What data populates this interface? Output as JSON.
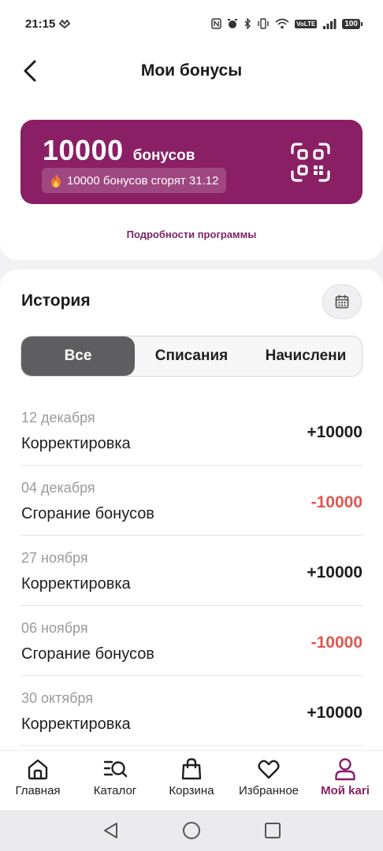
{
  "status_bar": {
    "time": "21:15",
    "battery": "100",
    "volte": "VoLTE"
  },
  "header": {
    "title": "Мои бонусы"
  },
  "bonus_card": {
    "amount": "10000",
    "unit": "бонусов",
    "expire_text": "10000 бонусов сгорят 31.12",
    "expire_icon": "fire-icon",
    "qr_icon": "qr-code-icon"
  },
  "program_link": "Подробности программы",
  "history": {
    "title": "История",
    "calendar_icon": "calendar-icon",
    "tabs": [
      {
        "label": "Все",
        "active": true
      },
      {
        "label": "Списания",
        "active": false
      },
      {
        "label": "Начислени",
        "active": false
      }
    ],
    "items": [
      {
        "date": "12 декабря",
        "title": "Корректировка",
        "amount": "+10000",
        "type": "plus"
      },
      {
        "date": "04 декабря",
        "title": "Сгорание бонусов",
        "amount": "-10000",
        "type": "minus"
      },
      {
        "date": "27 ноября",
        "title": "Корректировка",
        "amount": "+10000",
        "type": "plus"
      },
      {
        "date": "06 ноября",
        "title": "Сгорание бонусов",
        "amount": "-10000",
        "type": "minus"
      },
      {
        "date": "30 октября",
        "title": "Корректировка",
        "amount": "+10000",
        "type": "plus"
      }
    ]
  },
  "bottom_nav": [
    {
      "label": "Главная",
      "icon": "home-icon",
      "active": false
    },
    {
      "label": "Каталог",
      "icon": "catalog-search-icon",
      "active": false
    },
    {
      "label": "Корзина",
      "icon": "bag-icon",
      "active": false
    },
    {
      "label": "Избранное",
      "icon": "heart-icon",
      "active": false
    },
    {
      "label": "Мой kari",
      "icon": "profile-icon",
      "active": true
    }
  ],
  "colors": {
    "brand": "#8a1f66",
    "negative": "#e0574f",
    "tab_active": "#5e5e60"
  }
}
